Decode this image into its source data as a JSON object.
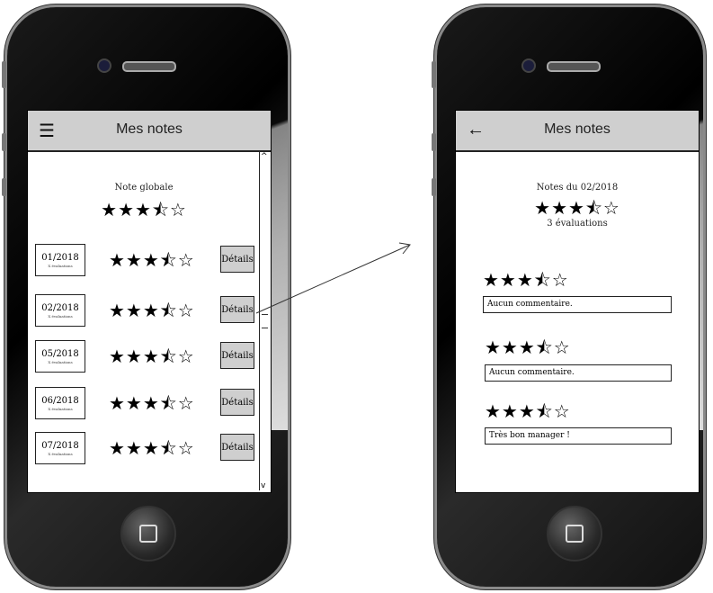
{
  "left_screen": {
    "title": "Mes notes",
    "menu_icon": "hamburger-icon",
    "global_label": "Note globale",
    "global_stars": "★★★⯪☆",
    "rows": [
      {
        "date": "01/2018",
        "note": "X évaluations",
        "stars": "★★★⯪☆",
        "button": "Détails"
      },
      {
        "date": "02/2018",
        "note": "X évaluations",
        "stars": "★★★⯪☆",
        "button": "Détails"
      },
      {
        "date": "05/2018",
        "note": "X évaluations",
        "stars": "★★★⯪☆",
        "button": "Détails"
      },
      {
        "date": "06/2018",
        "note": "X évaluations",
        "stars": "★★★⯪☆",
        "button": "Détails"
      },
      {
        "date": "07/2018",
        "note": "X évaluations",
        "stars": "★★★⯪☆",
        "button": "Détails"
      }
    ]
  },
  "right_screen": {
    "title": "Mes notes",
    "back_icon": "back-arrow-icon",
    "header_label": "Notes du 02/2018",
    "header_stars": "★★★⯪☆",
    "count": "3 évaluations",
    "reviews": [
      {
        "stars": "★★★⯪☆",
        "comment": "Aucun commentaire."
      },
      {
        "stars": "★★★⯪☆",
        "comment": "Aucun commentaire."
      },
      {
        "stars": "★★★⯪☆",
        "comment": "Très bon manager !"
      }
    ]
  }
}
